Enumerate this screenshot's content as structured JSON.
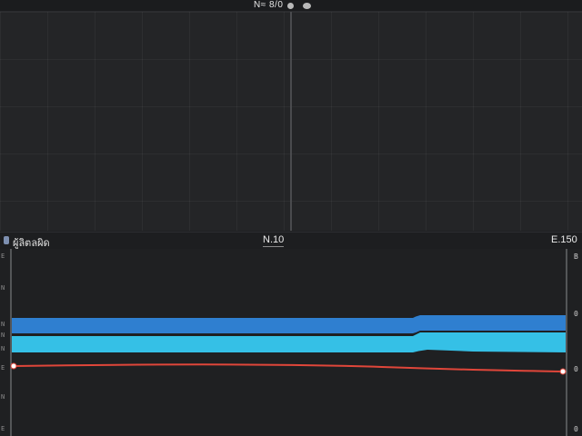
{
  "topbar": {
    "title": "N≈ 8/0"
  },
  "panel": {
    "title": "ผู้ลิตลผิด",
    "tab": "N.10",
    "right_label": "E.150"
  },
  "graph": {
    "left_ticks": [
      "E",
      "N",
      "N",
      "N",
      "N",
      "E",
      "N",
      "E"
    ],
    "right_ticks": [
      "B",
      "0",
      "0",
      "0"
    ],
    "colors": {
      "band_top": "#2f7fd0",
      "band_bottom": "#35c0e6",
      "line": "#e0463a",
      "frame": "#8a8b8e"
    }
  }
}
